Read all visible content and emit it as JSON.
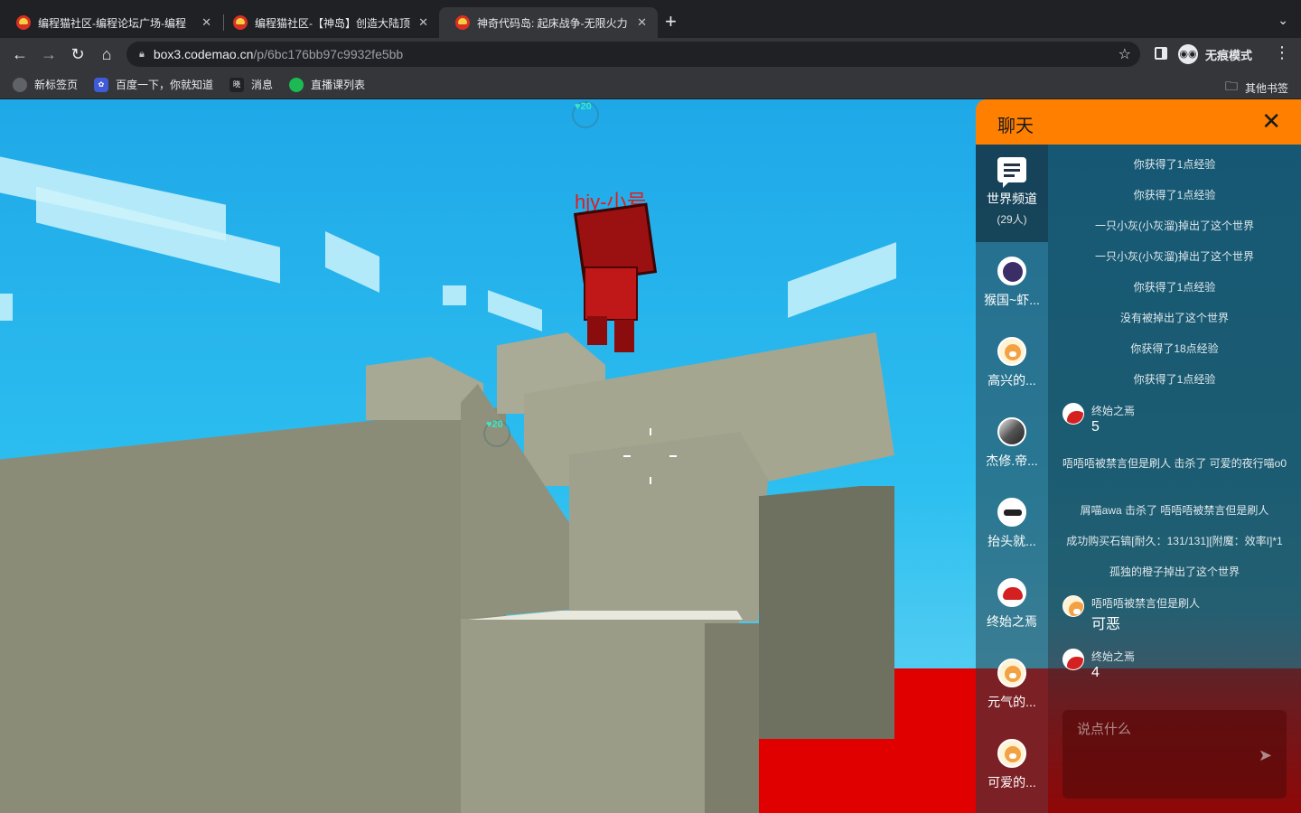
{
  "browser": {
    "tabs": [
      {
        "title": "编程猫社区-编程论坛广场-编程",
        "close": "✕"
      },
      {
        "title": "编程猫社区-【神岛】创造大陆顶",
        "close": "✕"
      },
      {
        "title": "神奇代码岛: 起床战争-无限火力",
        "close": "✕"
      }
    ],
    "new_tab": "+",
    "url_host": "box3.codemao.cn",
    "url_path": "/p/6bc176bb97c9932fe5bb",
    "incognito_label": "无痕模式",
    "bookmarks": [
      "新标签页",
      "百度一下，你就知道",
      "消息",
      "直播课列表"
    ],
    "other_bookmarks": "其他书签"
  },
  "game": {
    "player_name": "hjy-小号",
    "hp_top": "♥20",
    "hp_mid": "♥20"
  },
  "chat": {
    "title": "聊天",
    "close": "✕",
    "world_channel": {
      "name": "世界频道",
      "count": "(29人)"
    },
    "contacts": [
      {
        "name": "猴国~虾...",
        "avatar": "navy"
      },
      {
        "name": "高兴的...",
        "avatar": "cat"
      },
      {
        "name": "杰修.帝...",
        "avatar": "photo"
      },
      {
        "name": "抬头就...",
        "avatar": "glass"
      },
      {
        "name": "终始之焉",
        "avatar": "red"
      },
      {
        "name": "元气的...",
        "avatar": "cat"
      },
      {
        "name": "可爱的...",
        "avatar": "cat"
      }
    ],
    "messages": [
      {
        "type": "system",
        "text": "你获得了1点经验"
      },
      {
        "type": "system",
        "text": "你获得了1点经验"
      },
      {
        "type": "system",
        "text": "一只小灰(小灰溜)掉出了这个世界"
      },
      {
        "type": "system",
        "text": "一只小灰(小灰溜)掉出了这个世界"
      },
      {
        "type": "system",
        "text": "你获得了1点经验"
      },
      {
        "type": "system",
        "text": "没有被掉出了这个世界"
      },
      {
        "type": "system",
        "text": "你获得了18点经验"
      },
      {
        "type": "system",
        "text": "你获得了1点经验"
      },
      {
        "type": "user",
        "user": "终始之焉",
        "text": "5"
      },
      {
        "type": "system",
        "text": "唔唔唔被禁言但是刷人 击杀了 可爱的夜行喵o0"
      },
      {
        "type": "system",
        "text": "屑喵awa 击杀了 唔唔唔被禁言但是刷人"
      },
      {
        "type": "system",
        "text": "成功购买石镐[耐久：131/131][附魔：效率I]*1"
      },
      {
        "type": "system",
        "text": "孤独的橙子掉出了这个世界"
      },
      {
        "type": "user",
        "user": "唔唔唔被禁言但是刷人",
        "text": "可恶"
      },
      {
        "type": "user",
        "user": "终始之焉",
        "text": "4"
      }
    ],
    "input_placeholder": "说点什么",
    "send_icon": "➤"
  }
}
